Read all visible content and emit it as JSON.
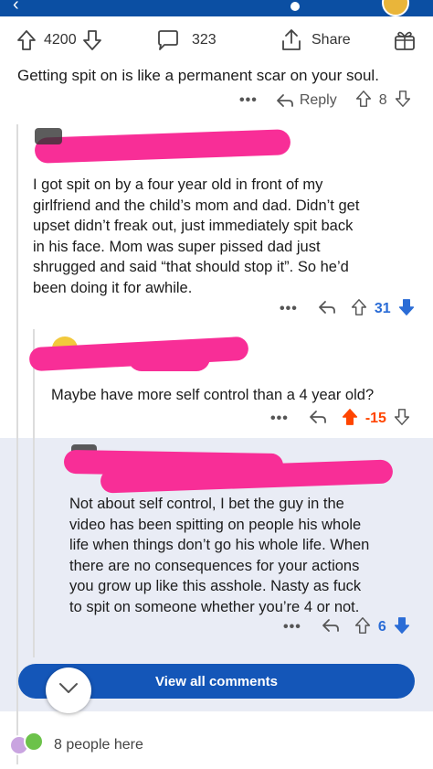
{
  "post_actions": {
    "upvotes": "4200",
    "comments": "323",
    "share_label": "Share"
  },
  "op_comment": {
    "text": "Getting spit on is like a permanent scar on your soul.",
    "more": "•••",
    "reply_label": "Reply",
    "votes": "8"
  },
  "comment_1": {
    "lines": [
      "I got spit on by a four year old in front of my",
      "girlfriend and the child’s mom and dad. Didn’t get",
      "upset didn’t freak out, just immediately spit back",
      "in his face. Mom was super pissed dad just",
      "shrugged and said “that should stop it”. So he’d",
      "been doing it for awhile."
    ],
    "more": "•••",
    "votes": "31"
  },
  "comment_2": {
    "text": "Maybe have more self control than a 4 year old?",
    "more": "•••",
    "votes": "-15"
  },
  "comment_3": {
    "lines": [
      "Not about self control, I bet the guy in the",
      "video has been spitting on people his whole",
      "life when things don’t go his whole life. When",
      "there are no consequences for your actions",
      "you grow up like this asshole. Nasty as fuck",
      "to spit on someone whether you’re 4 or not."
    ],
    "more": "•••",
    "votes": "6"
  },
  "view_all_label": "View all comments",
  "presence": {
    "text": "8 people here"
  },
  "colors": {
    "topbar": "#0b4fa3",
    "upvote_active": "#ff4500",
    "downvote_active": "#2a6cd6",
    "button": "#1456b8",
    "redaction": "#f82e97",
    "highlight": "#e9ecf5"
  }
}
